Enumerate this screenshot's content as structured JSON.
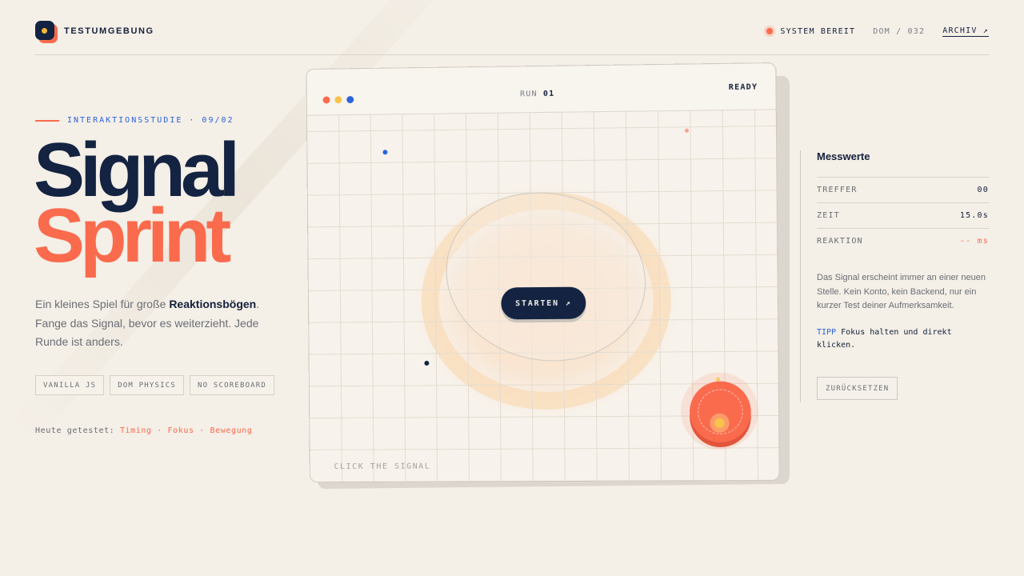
{
  "header": {
    "brand": "TESTUMGEBUNG",
    "status": "SYSTEM BEREIT",
    "dom_counter": "DOM / 032",
    "archive_link": "ARCHIV ↗"
  },
  "hero": {
    "kicker": "INTERAKTIONSSTUDIE · 09/02",
    "title_line1": "Signal",
    "title_line2": "Sprint",
    "description_pre": "Ein kleines Spiel für große ",
    "description_bold": "Reaktionsbögen",
    "description_post": ". Fange das Signal, bevor es weiterzieht. Jede Runde ist anders.",
    "tags": [
      "VANILLA JS",
      "DOM PHYSICS",
      "NO SCOREBOARD"
    ],
    "tested_label": "Heute getestet:",
    "tested_items": "Timing · Fokus · Bewegung"
  },
  "game": {
    "run_label": "RUN",
    "run_number": "01",
    "state": "READY",
    "start_button": "STARTEN ↗",
    "hint": "CLICK THE SIGNAL",
    "window_dots": [
      "#fa6b4d",
      "#f7c34a",
      "#2b63d9"
    ]
  },
  "panel": {
    "title": "Messwerte",
    "metrics": [
      {
        "key": "TREFFER",
        "value": "00"
      },
      {
        "key": "ZEIT",
        "value": "15.0s"
      },
      {
        "key": "REAKTION",
        "value": "-- ms"
      }
    ],
    "text": "Das Signal erscheint immer an einer neuen Stelle. Kein Konto, kein Backend, nur ein kurzer Test deiner Aufmerksamkeit.",
    "tip_label": "TIPP",
    "tip_text": "Fokus halten und direkt klicken.",
    "reset_button": "ZURÜCKSETZEN"
  },
  "colors": {
    "navy": "#132341",
    "coral": "#fa6b4d",
    "blue": "#2b63d9",
    "yellow": "#f7c34a",
    "background": "#f4efe7"
  }
}
